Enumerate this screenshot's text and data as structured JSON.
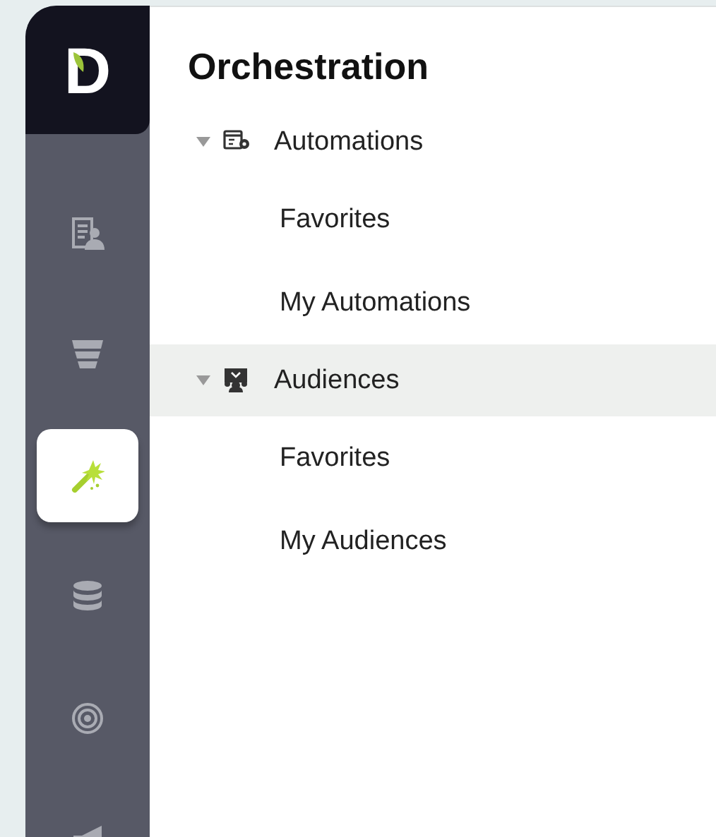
{
  "sidebar": {
    "logo": "D",
    "items": [
      {
        "kind": "contacts",
        "selected": false
      },
      {
        "kind": "funnel",
        "selected": false
      },
      {
        "kind": "wand",
        "selected": true
      },
      {
        "kind": "database",
        "selected": false
      },
      {
        "kind": "target",
        "selected": false
      },
      {
        "kind": "megaphone",
        "selected": false
      }
    ]
  },
  "panel": {
    "title": "Orchestration",
    "tree": [
      {
        "label": "Automations",
        "kind": "automations",
        "expanded": true,
        "selected": false,
        "children": [
          {
            "label": "Favorites",
            "selected": false
          },
          {
            "label": "My Automations",
            "selected": false
          }
        ]
      },
      {
        "label": "Audiences",
        "kind": "audiences",
        "expanded": true,
        "selected": true,
        "children": [
          {
            "label": "Favorites",
            "selected": false
          },
          {
            "label": "My Audiences",
            "selected": false
          }
        ]
      }
    ]
  }
}
